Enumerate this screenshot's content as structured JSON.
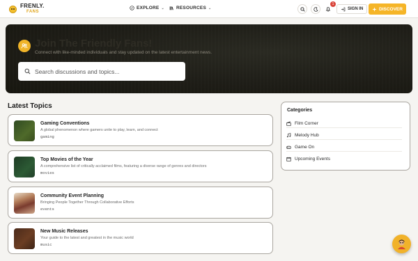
{
  "brand": {
    "name": "FRENLY.",
    "sub": "FANS"
  },
  "nav": {
    "explore": "EXPLORE",
    "resources": "RESOURCES",
    "signin": "SIGN IN",
    "discover": "DISCOVER",
    "notification_count": "1"
  },
  "hero": {
    "title": "Join The Friendly Fans!",
    "subtitle": "Connect with like-minded individuals and stay updated on the latest entertainment news.",
    "search_placeholder": "Search discussions and topics..."
  },
  "latest": {
    "heading": "Latest Topics",
    "topics": [
      {
        "title": "Gaming Conventions",
        "desc": "A global phenomenon where gamers unite to play, learn, and connect",
        "tag": "gaming"
      },
      {
        "title": "Top Movies of the Year",
        "desc": "A comprehensive list of critically acclaimed films, featuring a diverse range of genres and directors",
        "tag": "movies"
      },
      {
        "title": "Community Event Planning",
        "desc": "Bringing People Together Through Collaborative Efforts",
        "tag": "events"
      },
      {
        "title": "New Music Releases",
        "desc": "Your guide to the latest and greatest in the music world",
        "tag": "music"
      }
    ]
  },
  "categories": {
    "heading": "Categories",
    "items": [
      {
        "label": "Film Corner",
        "icon": "film-icon"
      },
      {
        "label": "Melody Hub",
        "icon": "music-icon"
      },
      {
        "label": "Game On",
        "icon": "gamepad-icon"
      },
      {
        "label": "Upcoming Events",
        "icon": "calendar-icon"
      }
    ]
  },
  "colors": {
    "accent": "#f5b528",
    "hero_bg": "#1e1d17",
    "badge": "#d9443a"
  }
}
